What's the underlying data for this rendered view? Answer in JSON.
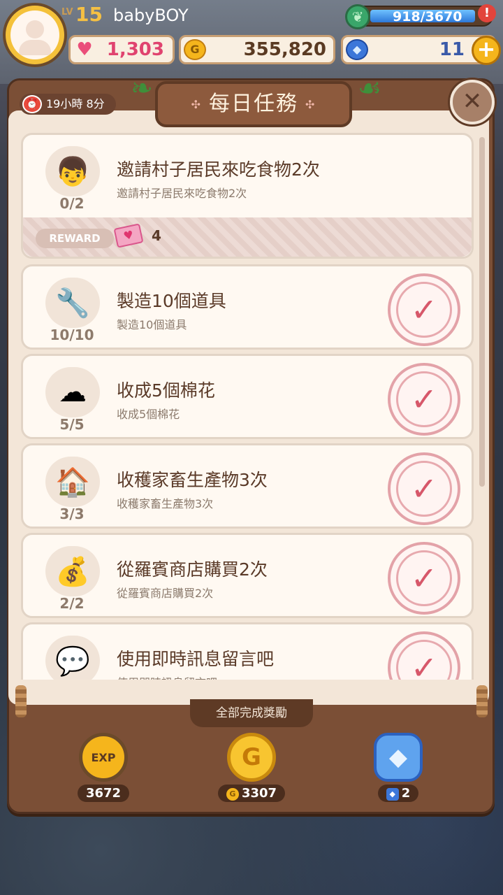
{
  "hud": {
    "lv_label": "LV",
    "level": "15",
    "player_name": "babyBOY",
    "energy": "918/3670",
    "alert": "!",
    "hearts": "1,303",
    "gold": "355,820",
    "gems": "11",
    "plus": "+"
  },
  "panel": {
    "timer": "19小時 8分",
    "title": "每日任務",
    "close": "✕"
  },
  "tasks": [
    {
      "title": "邀請村子居民來吃食物2次",
      "subtitle": "邀請村子居民來吃食物2次",
      "progress": "0/2",
      "reward_label": "REWARD",
      "reward_count": "4",
      "icon": "chef-fork-icon"
    },
    {
      "title": "製造10個道具",
      "subtitle": "製造10個道具",
      "progress": "10/10",
      "icon": "tools-icon",
      "completed": true
    },
    {
      "title": "收成5個棉花",
      "subtitle": "收成5個棉花",
      "progress": "5/5",
      "icon": "cotton-icon",
      "completed": true
    },
    {
      "title": "收穫家畜生產物3次",
      "subtitle": "收穫家畜生產物3次",
      "progress": "3/3",
      "icon": "farm-building-icon",
      "completed": true
    },
    {
      "title": "從羅賓商店購買2次",
      "subtitle": "從羅賓商店購買2次",
      "progress": "2/2",
      "icon": "gold-bag-icon",
      "completed": true
    },
    {
      "title": "使用即時訊息留言吧",
      "subtitle": "使用即時訊息留言吧",
      "progress": "",
      "icon": "chat-icon",
      "completed": true
    }
  ],
  "bottom": {
    "title": "全部完成獎勵",
    "exp_label": "EXP",
    "exp": "3672",
    "gold": "3307",
    "gems": "2"
  }
}
